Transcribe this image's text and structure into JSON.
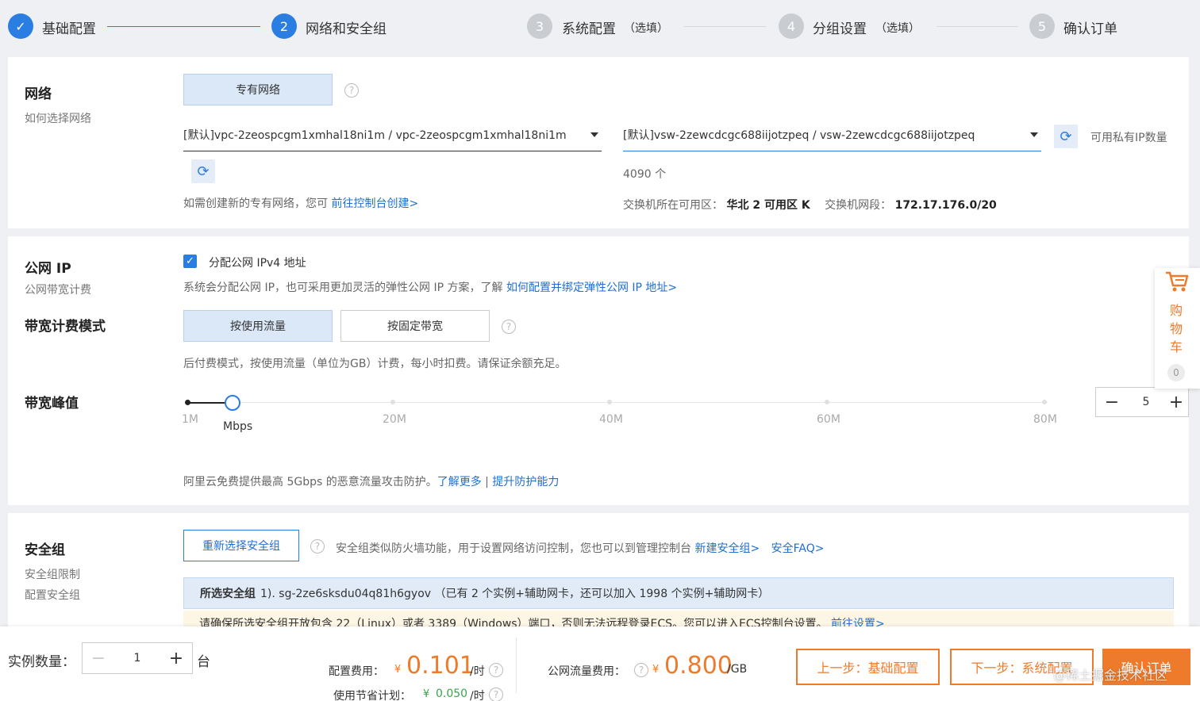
{
  "steps": [
    {
      "num": "✓",
      "label": "基础配置",
      "optional": ""
    },
    {
      "num": "2",
      "label": "网络和安全组",
      "optional": ""
    },
    {
      "num": "3",
      "label": "系统配置",
      "optional": "（选填）"
    },
    {
      "num": "4",
      "label": "分组设置",
      "optional": "（选填）"
    },
    {
      "num": "5",
      "label": "确认订单",
      "optional": ""
    }
  ],
  "network": {
    "title": "网络",
    "subtitle": "如何选择网络",
    "type_button": "专有网络",
    "vpc_value": "[默认]vpc-2zeospcgm1xmhal18ni1m / vpc-2zeospcgm1xmhal18ni1m",
    "vsw_value": "[默认]vsw-2zewcdcgc688iijotzpeq / vsw-2zewcdcgc688iijotzpeq",
    "ip_count_label": "可用私有IP数量",
    "ip_count_value": "4090 个",
    "create_hint": "如需创建新的专有网络，您可",
    "create_link": "前往控制台创建>",
    "zone_label": "交换机所在可用区：",
    "zone_value": "华北 2 可用区 K",
    "cidr_label": "交换机网段：",
    "cidr_value": "172.17.176.0/20"
  },
  "public_ip": {
    "title": "公网 IP",
    "subtitle": "公网带宽计费",
    "checkbox_label": "分配公网 IPv4 地址",
    "hint": "系统会分配公网 IP，也可采用更加灵活的弹性公网 IP 方案，了解",
    "hint_link": "如何配置并绑定弹性公网 IP 地址>",
    "billing_title": "带宽计费模式",
    "billing_by_traffic": "按使用流量",
    "billing_fixed": "按固定带宽",
    "billing_hint": "后付费模式，按使用流量（单位为GB）计费，每小时扣费。请保证余额充足。",
    "peak_title": "带宽峰值",
    "slider": {
      "min": 1,
      "max": 80,
      "value": 5,
      "ticks": [
        "1M",
        "20M",
        "40M",
        "60M",
        "80M"
      ],
      "unit": "Mbps"
    },
    "stepper_value": "5",
    "ddos_hint": "阿里云免费提供最高 5Gbps 的恶意流量攻击防护。",
    "ddos_link1": "了解更多",
    "ddos_sep": " | ",
    "ddos_link2": "提升防护能力"
  },
  "cart": {
    "chars": [
      "购",
      "物",
      "车"
    ],
    "count": "0"
  },
  "security_group": {
    "title": "安全组",
    "sub1": "安全组限制",
    "sub2": "配置安全组",
    "reselect_button": "重新选择安全组",
    "hint": "安全组类似防火墙功能，用于设置网络访问控制，您也可以到管理控制台",
    "link_create": "新建安全组>",
    "link_faq": "安全FAQ>",
    "selected_label": "所选安全组",
    "selected_value": "1). sg-2ze6sksdu04q81h6gyov （已有 2 个实例+辅助网卡，还可以加入 1998 个实例+辅助网卡）",
    "warning": "请确保所选安全组开放包含 22（Linux）或者 3389（Windows）端口，否则无法远程登录ECS。您可以进入ECS控制台设置。",
    "warning_link": "前往设置>"
  },
  "bottom": {
    "qty_label": "实例数量：",
    "qty_value": "1",
    "qty_unit": "台",
    "config_fee_label": "配置费用：",
    "config_fee_value": "0.101",
    "config_fee_unit": "/时",
    "savings_label": "使用节省计划：",
    "savings_value": "0.050",
    "savings_unit": "/时",
    "traffic_fee_label": "公网流量费用：",
    "traffic_fee_value": "0.800",
    "traffic_fee_unit": "/GB",
    "yen": "¥",
    "prev_button": "上一步：基础配置",
    "next_button": "下一步：系统配置",
    "confirm_button": "确认订单",
    "watermark": "@稀土掘金技术社区"
  },
  "colors": {
    "primary": "#2a7de1",
    "accent": "#ee7a2b"
  }
}
